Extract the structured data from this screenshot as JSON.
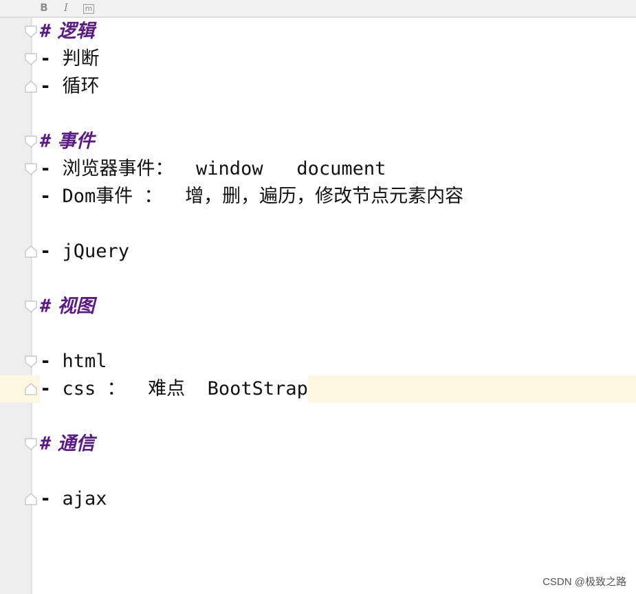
{
  "toolbar": {
    "bold_label": "B",
    "italic_label": "I",
    "code_label": "m"
  },
  "editor": {
    "lines": [
      {
        "kind": "heading",
        "marker": "#",
        "text": "逻辑"
      },
      {
        "kind": "item",
        "marker": "-",
        "text": "判断"
      },
      {
        "kind": "item",
        "marker": "-",
        "text": "循环"
      },
      {
        "kind": "heading",
        "marker": "#",
        "text": "事件"
      },
      {
        "kind": "item",
        "marker": "-",
        "text": "浏览器事件：  window   document"
      },
      {
        "kind": "item",
        "marker": "-",
        "text": "Dom事件 ：  增，删，遍历，修改节点元素内容"
      },
      {
        "kind": "item",
        "marker": "-",
        "text": "jQuery"
      },
      {
        "kind": "heading",
        "marker": "#",
        "text": "视图"
      },
      {
        "kind": "item",
        "marker": "-",
        "text": "html"
      },
      {
        "kind": "item",
        "marker": "-",
        "text": "css ：  难点  BootStrap"
      },
      {
        "kind": "heading",
        "marker": "#",
        "text": "通信"
      },
      {
        "kind": "item",
        "marker": "-",
        "text": "ajax"
      }
    ]
  },
  "watermark": "CSDN @极致之路"
}
